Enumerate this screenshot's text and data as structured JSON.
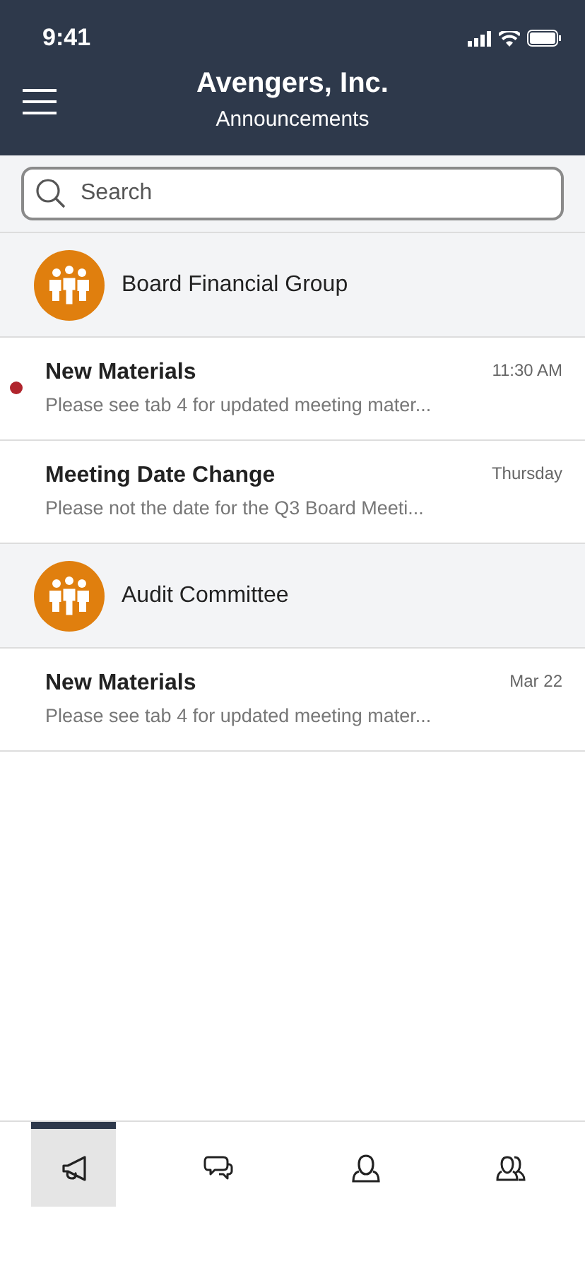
{
  "status_bar": {
    "time": "9:41"
  },
  "header": {
    "title": "Avengers, Inc.",
    "subtitle": "Announcements"
  },
  "search": {
    "placeholder": "Search"
  },
  "groups": [
    {
      "name": "Board Financial Group",
      "messages": [
        {
          "title": "New Materials",
          "preview": "Please see tab 4 for updated meeting mater...",
          "time": "11:30 AM",
          "unread": true
        },
        {
          "title": "Meeting Date Change",
          "preview": "Please not the date for the Q3 Board Meeti...",
          "time": "Thursday",
          "unread": false
        }
      ]
    },
    {
      "name": "Audit Committee",
      "messages": [
        {
          "title": "New Materials",
          "preview": "Please see tab 4 for updated meeting mater...",
          "time": "Mar 22",
          "unread": false
        }
      ]
    }
  ],
  "tabs": [
    {
      "kind": "announcements",
      "selected": true
    },
    {
      "kind": "chat",
      "selected": false
    },
    {
      "kind": "person",
      "selected": false
    },
    {
      "kind": "people",
      "selected": false
    }
  ]
}
